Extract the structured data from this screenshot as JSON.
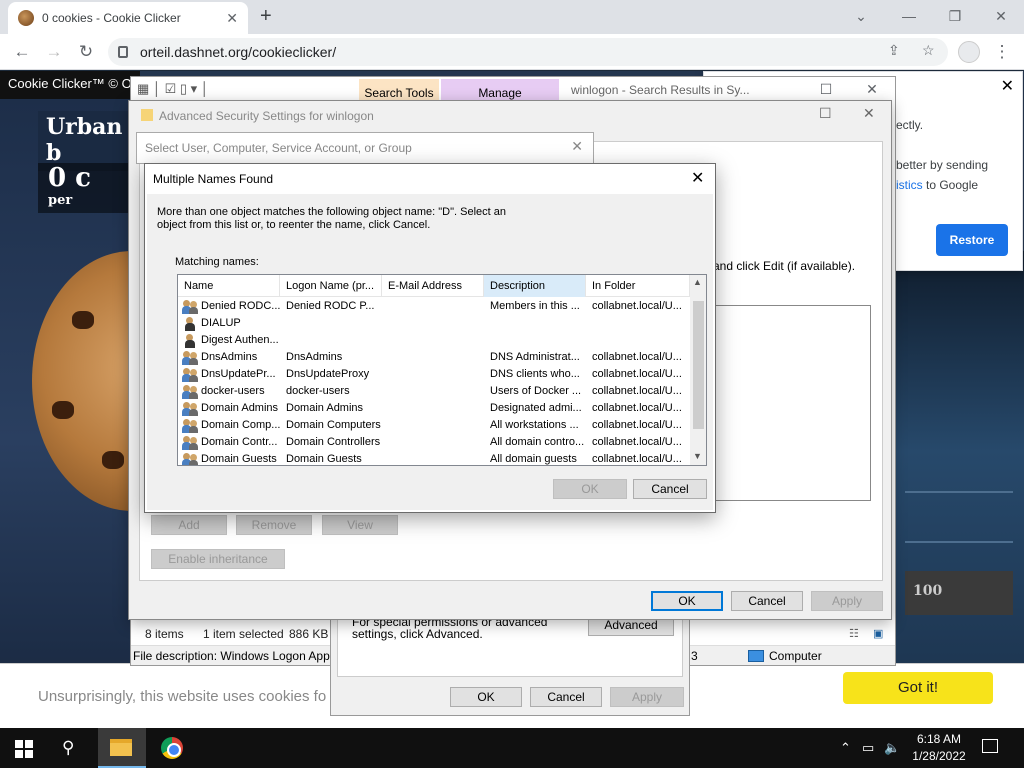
{
  "browser": {
    "tab_title": "0 cookies - Cookie Clicker",
    "url": "orteil.dashnet.org/cookieclicker/"
  },
  "cookie_page": {
    "topbar": "Cookie Clicker™ © O",
    "banner": "Urban b",
    "count": "0 c",
    "count_sub": "per",
    "store_num": "100"
  },
  "restore_popup": {
    "text1": "ectly.",
    "text2": "better by sending",
    "text3_link": "istics",
    "text3_rest": " to Google",
    "button": "Restore"
  },
  "cookie_banner": {
    "message": "Unsurprisingly, this website uses cookies fo",
    "button": "Got it!"
  },
  "explorer": {
    "tab_search_tools": "Search Tools",
    "tab_manage": "Manage",
    "window_title": "winlogon - Search Results in Sy...",
    "status_items": "8 items",
    "status_selected": "1 item selected",
    "status_size": "886 KB",
    "file_description": "File description: Windows Logon App",
    "desc_extra": "3",
    "computer": "Computer"
  },
  "properties": {
    "text": "For special permissions or advanced settings, click Advanced.",
    "advanced": "Advanced",
    "ok": "OK",
    "cancel": "Cancel",
    "apply": "Apply"
  },
  "advanced_security": {
    "title": "Advanced Security Settings for winlogon",
    "edit_hint": "and click Edit (if available).",
    "add": "Add",
    "remove": "Remove",
    "view": "View",
    "enable_inheritance": "Enable inheritance",
    "ok": "OK",
    "cancel": "Cancel",
    "apply": "Apply"
  },
  "select_user": {
    "title": "Select User, Computer, Service Account, or Group"
  },
  "dialog": {
    "title": "Multiple Names Found",
    "description": "More than one object matches the following object name: \"D\". Select an object from this list or, to reenter the name, click Cancel.",
    "matching_label": "Matching names:",
    "columns": [
      "Name",
      "Logon Name (pr...",
      "E-Mail Address",
      "Description",
      "In Folder"
    ],
    "rows": [
      {
        "name": "Denied RODC...",
        "logon": "Denied RODC P...",
        "email": "",
        "desc": "Members in this ...",
        "folder": "collabnet.local/U...",
        "icon": "group-icon"
      },
      {
        "name": "DIALUP",
        "logon": "",
        "email": "",
        "desc": "",
        "folder": "",
        "icon": "user-icon"
      },
      {
        "name": "Digest Authen...",
        "logon": "",
        "email": "",
        "desc": "",
        "folder": "",
        "icon": "user-icon"
      },
      {
        "name": "DnsAdmins",
        "logon": "DnsAdmins",
        "email": "",
        "desc": "DNS Administrat...",
        "folder": "collabnet.local/U...",
        "icon": "group-icon"
      },
      {
        "name": "DnsUpdatePr...",
        "logon": "DnsUpdateProxy",
        "email": "",
        "desc": "DNS clients who...",
        "folder": "collabnet.local/U...",
        "icon": "group-icon"
      },
      {
        "name": "docker-users",
        "logon": "docker-users",
        "email": "",
        "desc": "Users of Docker ...",
        "folder": "collabnet.local/U...",
        "icon": "group-icon"
      },
      {
        "name": "Domain Admins",
        "logon": "Domain Admins",
        "email": "",
        "desc": "Designated admi...",
        "folder": "collabnet.local/U...",
        "icon": "group-icon"
      },
      {
        "name": "Domain Comp...",
        "logon": "Domain Computers",
        "email": "",
        "desc": "All workstations ...",
        "folder": "collabnet.local/U...",
        "icon": "group-icon"
      },
      {
        "name": "Domain Contr...",
        "logon": "Domain Controllers",
        "email": "",
        "desc": "All domain contro...",
        "folder": "collabnet.local/U...",
        "icon": "group-icon"
      },
      {
        "name": "Domain Guests",
        "logon": "Domain Guests",
        "email": "",
        "desc": "All domain guests",
        "folder": "collabnet.local/U...",
        "icon": "group-icon"
      }
    ],
    "ok": "OK",
    "cancel": "Cancel"
  },
  "taskbar": {
    "time": "6:18 AM",
    "date": "1/28/2022"
  }
}
